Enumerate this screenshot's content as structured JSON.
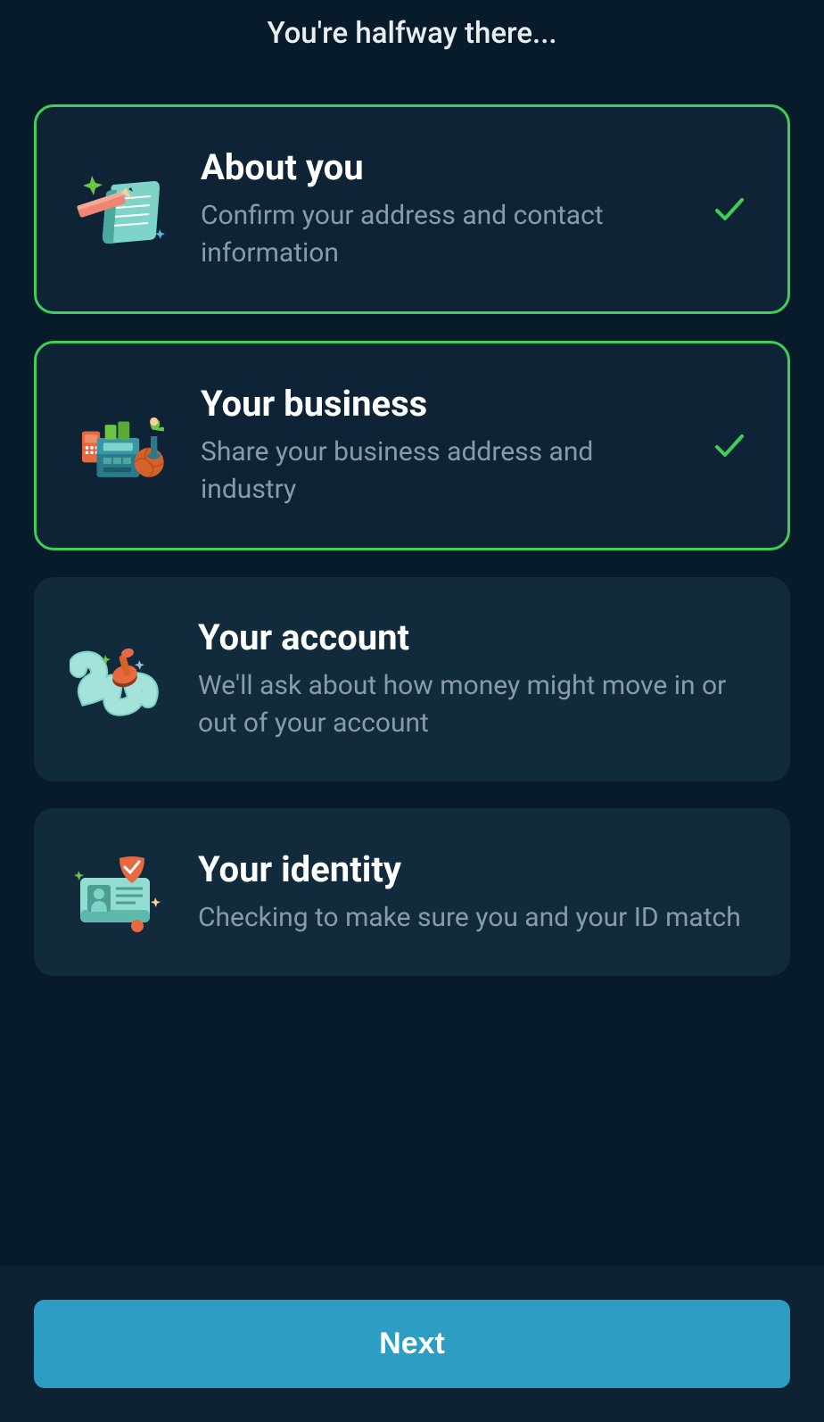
{
  "header": {
    "title": "You're halfway there..."
  },
  "steps": [
    {
      "title": "About you",
      "description": "Confirm your address and contact information",
      "completed": true
    },
    {
      "title": "Your business",
      "description": "Share your business address and industry",
      "completed": true
    },
    {
      "title": "Your account",
      "description": "We'll ask about how money might move in or out of your account",
      "completed": false
    },
    {
      "title": "Your identity",
      "description": "Checking to make sure you and your ID match",
      "completed": false
    }
  ],
  "footer": {
    "next_label": "Next"
  }
}
